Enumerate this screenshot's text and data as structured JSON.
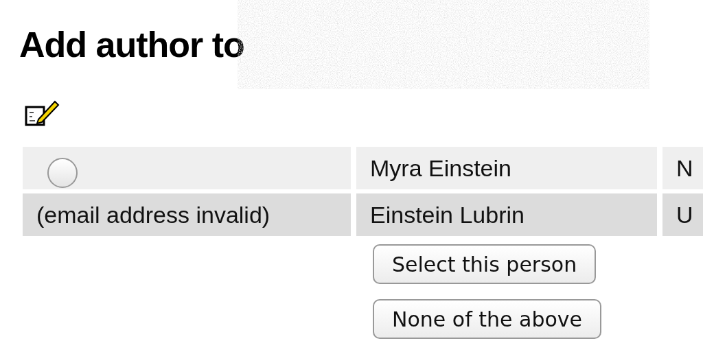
{
  "title": "Add author to",
  "rows": [
    {
      "kind": "radio",
      "selected": false,
      "name": "Myra Einstein",
      "column_3": "N"
    },
    {
      "kind": "note",
      "note": "(email address invalid)",
      "name": "Einstein Lubrin",
      "column_3": "U"
    }
  ],
  "buttons": [
    "Select this person",
    "None of the above"
  ]
}
